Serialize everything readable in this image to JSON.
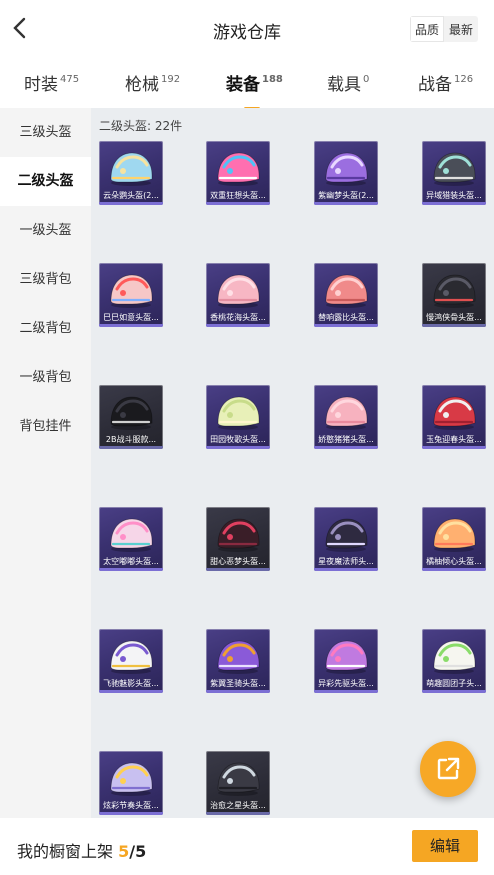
{
  "header": {
    "title": "游戏仓库",
    "sort_options": [
      "品质",
      "最新"
    ],
    "active_sort": "品质"
  },
  "tabs": [
    {
      "label": "时装",
      "count": "475"
    },
    {
      "label": "枪械",
      "count": "192"
    },
    {
      "label": "装备",
      "count": "188",
      "active": true
    },
    {
      "label": "载具",
      "count": "0"
    },
    {
      "label": "战备",
      "count": "126"
    }
  ],
  "sidebar": {
    "items": [
      "三级头盔",
      "二级头盔",
      "一级头盔",
      "三级背包",
      "二级背包",
      "一级背包",
      "背包挂件"
    ],
    "active": "二级头盔"
  },
  "section": {
    "count_label": "二级头盔: 22件"
  },
  "items": [
    {
      "name": "云朵鹦头盔(2...",
      "colors": [
        "#9fd8f0",
        "#f6e3a0",
        "#ffd36b"
      ]
    },
    {
      "name": "双重狂想头盔...",
      "colors": [
        "#ff6fb0",
        "#4fc3f7",
        "#ffffff"
      ]
    },
    {
      "name": "紫幽梦头盔(2...",
      "colors": [
        "#9b6ee0",
        "#e8d8ff",
        "#5a3aa0"
      ]
    },
    {
      "name": "异域猎装头盔...",
      "colors": [
        "#4a4e58",
        "#9fe0d8",
        "#e0e0e0"
      ]
    },
    {
      "name": "巳巳如意头盔...",
      "colors": [
        "#f6c7c7",
        "#ff5a5a",
        "#7fb0ff"
      ]
    },
    {
      "name": "香桃花海头盔...",
      "colors": [
        "#f7b7c4",
        "#ffe0e6",
        "#e48ea0"
      ]
    },
    {
      "name": "替响露比头盔...",
      "colors": [
        "#f08a8a",
        "#ffd0d0",
        "#c95a5a"
      ]
    },
    {
      "name": "慢鸿侠骨头盔...",
      "colors": [
        "#2a2a30",
        "#5a5a66",
        "#e05050"
      ]
    },
    {
      "name": "2B战斗服款...",
      "colors": [
        "#1a1a1e",
        "#3a3a44",
        "#d0d0d0"
      ]
    },
    {
      "name": "田园牧歌头盔...",
      "colors": [
        "#e8f0b8",
        "#c8dc8a",
        "#fff6cc"
      ]
    },
    {
      "name": "娇憨猪猪头盔...",
      "colors": [
        "#f7b2bf",
        "#ffd7de",
        "#e8899c"
      ]
    },
    {
      "name": "玉兔迎春头盔...",
      "colors": [
        "#d83a46",
        "#f0f0f0",
        "#a02030"
      ]
    },
    {
      "name": "太空嘟嘟头盔...",
      "colors": [
        "#f6d6e8",
        "#ff8fc8",
        "#5ad0d0"
      ]
    },
    {
      "name": "甜心恶梦头盔...",
      "colors": [
        "#3a1e28",
        "#e04060",
        "#8a2a40"
      ]
    },
    {
      "name": "星夜魔法师头...",
      "colors": [
        "#2e2a40",
        "#9a90c0",
        "#e0d8ff"
      ]
    },
    {
      "name": "橘柚倾心头盔...",
      "colors": [
        "#ffb070",
        "#ffe0a0",
        "#ff7a5a"
      ]
    },
    {
      "name": "飞驰魅影头盔...",
      "colors": [
        "#f4f4f6",
        "#7a5ad0",
        "#f0c040"
      ]
    },
    {
      "name": "紫翼圣骑头盔...",
      "colors": [
        "#8a5ad8",
        "#f0a030",
        "#e8e0ff"
      ]
    },
    {
      "name": "异彩先驱头盔...",
      "colors": [
        "#c07ae0",
        "#ff7ac0",
        "#ffffff"
      ]
    },
    {
      "name": "萌趣圆团子头...",
      "colors": [
        "#f6f6f0",
        "#8adc6a",
        "#e0e0e0"
      ]
    },
    {
      "name": "炫彩节奏头盔...",
      "colors": [
        "#c8c0f0",
        "#ffd050",
        "#8070d0"
      ]
    },
    {
      "name": "治愈之星头盔...",
      "colors": [
        "#3a3a44",
        "#cfd8e0",
        "#1e1e24"
      ]
    }
  ],
  "bottom": {
    "prefix": "我的橱窗上架",
    "current": "5",
    "total": "/5",
    "edit_label": "编辑"
  }
}
